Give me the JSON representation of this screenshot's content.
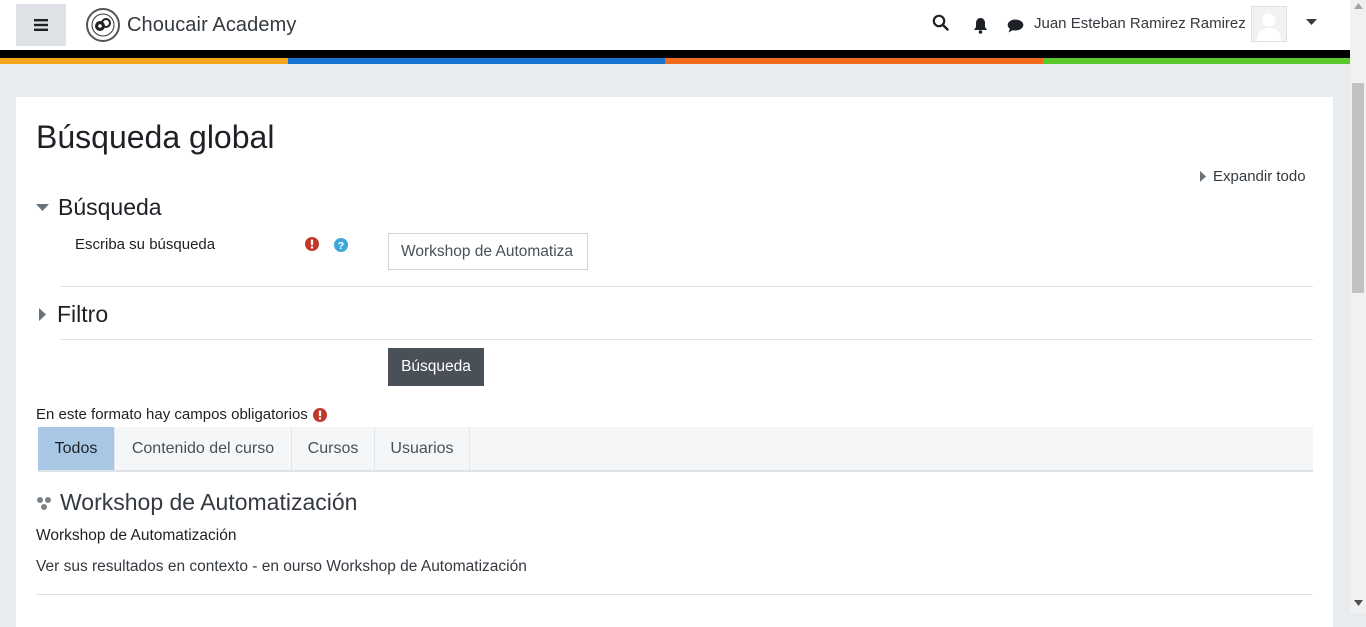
{
  "navbar": {
    "site_name": "Choucair Academy",
    "user_name": "Juan Esteban Ramirez Ramirez",
    "icons": {
      "menu": "hamburger-icon",
      "search": "search-icon",
      "notifications": "bell-icon",
      "messages": "chat-icon",
      "user_menu": "caret-down-icon"
    }
  },
  "stripes": {
    "colors": [
      "#f7a51c",
      "#1a75d2",
      "#f26b1a",
      "#5ac82d"
    ]
  },
  "page": {
    "title": "Búsqueda global",
    "expand_all": "Expandir todo"
  },
  "form": {
    "section_search": "Búsqueda",
    "search_label": "Escriba su búsqueda",
    "search_value": "Workshop de Automatiza",
    "section_filter": "Filtro",
    "submit_label": "Búsqueda",
    "required_note": "En este formato hay campos obligatorios"
  },
  "tabs": [
    {
      "label": "Todos",
      "active": true
    },
    {
      "label": "Contenido del curso",
      "active": false
    },
    {
      "label": "Cursos",
      "active": false
    },
    {
      "label": "Usuarios",
      "active": false
    }
  ],
  "results": [
    {
      "title": "Workshop de Automatización",
      "description": "Workshop de Automatización",
      "context_link": "Ver sus resultados en contexto - en ourso Workshop de Automatización",
      "icon": "course-icon"
    }
  ],
  "colors": {
    "required": "#c0392b",
    "help": "#3ea6d8",
    "active_tab": "#a7c7e5",
    "primary_button": "#495057"
  }
}
